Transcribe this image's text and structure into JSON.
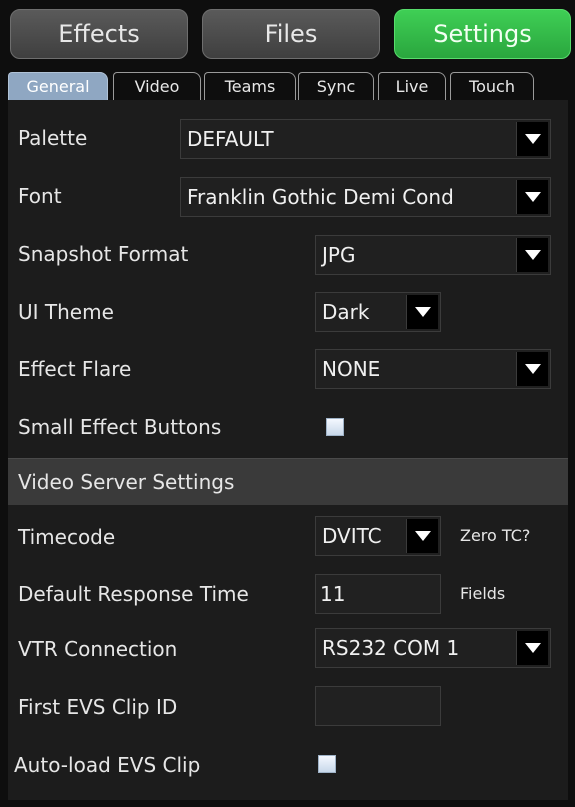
{
  "top_buttons": {
    "effects": "Effects",
    "files": "Files",
    "settings": "Settings"
  },
  "tabs": [
    "General",
    "Video",
    "Teams",
    "Sync",
    "Live",
    "Touch"
  ],
  "general": {
    "palette": {
      "label": "Palette",
      "value": "DEFAULT"
    },
    "font": {
      "label": "Font",
      "value": "Franklin Gothic Demi Cond"
    },
    "snapshot_format": {
      "label": "Snapshot Format",
      "value": "JPG"
    },
    "ui_theme": {
      "label": "UI Theme",
      "value": "Dark"
    },
    "effect_flare": {
      "label": "Effect Flare",
      "value": "NONE"
    },
    "small_effect_buttons": {
      "label": "Small Effect Buttons",
      "checked": false
    }
  },
  "video_server": {
    "header": "Video Server Settings",
    "timecode": {
      "label": "Timecode",
      "value": "DVITC",
      "note": "Zero TC?"
    },
    "default_response_time": {
      "label": "Default Response Time",
      "value": "11",
      "unit": "Fields"
    },
    "vtr_connection": {
      "label": "VTR Connection",
      "value": "RS232 COM 1"
    },
    "first_evs_clip_id": {
      "label": "First EVS Clip ID",
      "value": ""
    },
    "auto_load_evs_clip": {
      "label": "Auto-load EVS Clip",
      "checked": false
    }
  },
  "colors": {
    "accent_green": "#3fcf55",
    "active_tab": "#8fa7c2",
    "panel_bg": "#1c1c1c"
  }
}
